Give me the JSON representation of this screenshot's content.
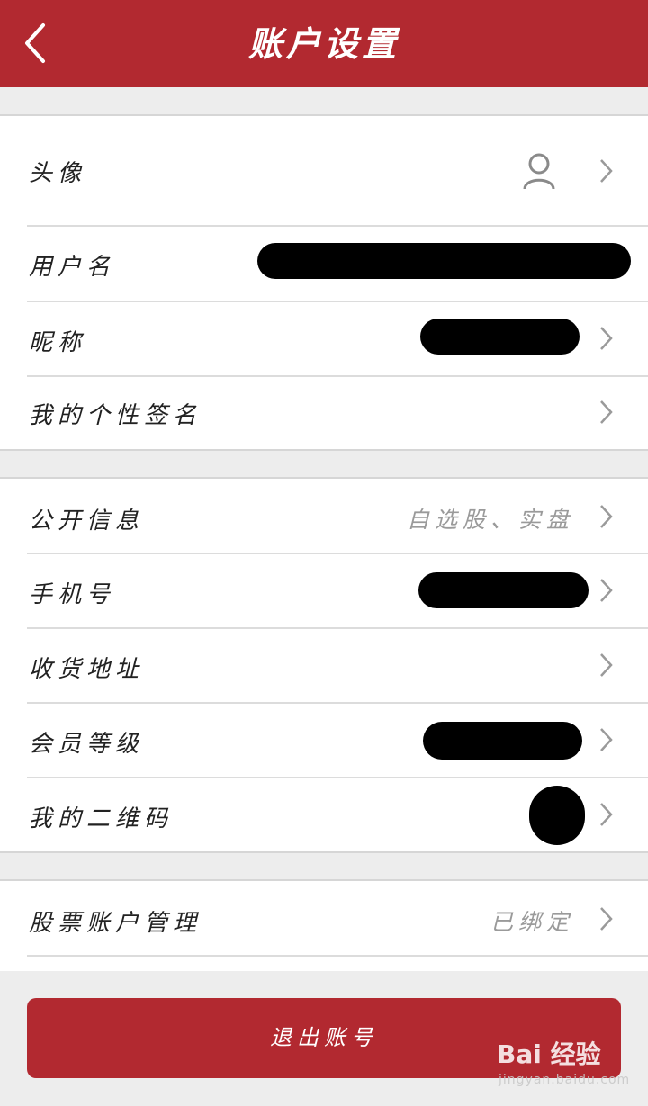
{
  "header": {
    "title": "账户设置",
    "back_icon": "chevron-left-icon"
  },
  "group1": {
    "avatar_label": "头像",
    "username_label": "用户名",
    "nickname_label": "昵称",
    "signature_label": "我的个性签名"
  },
  "group2": {
    "public_info_label": "公开信息",
    "public_info_value": "自选股、实盘",
    "phone_label": "手机号",
    "address_label": "收货地址",
    "member_level_label": "会员等级",
    "qrcode_label": "我的二维码"
  },
  "group3": {
    "stock_account_label": "股票账户管理",
    "stock_account_value": "已绑定"
  },
  "logout_label": "退出账号",
  "watermark": {
    "logo": "Bai 经验",
    "url": "jingyan.baidu.com"
  },
  "colors": {
    "accent": "#b22930",
    "background": "#ededed",
    "muted_text": "#9a9a9a"
  }
}
